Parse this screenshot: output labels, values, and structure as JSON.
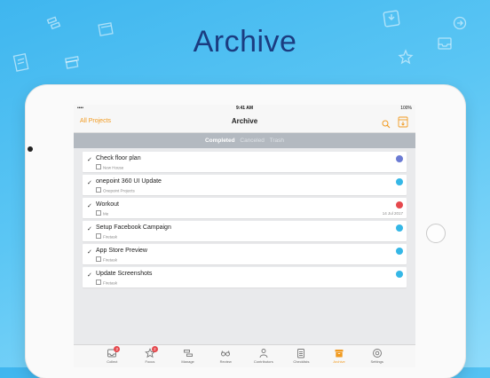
{
  "hero": {
    "title": "Archive"
  },
  "status": {
    "time": "9:41 AM",
    "signal": "•••• ",
    "battery": "100%"
  },
  "navbar": {
    "back": "All Projects",
    "title": "Archive"
  },
  "segments": [
    {
      "label": "Completed",
      "active": true
    },
    {
      "label": "Canceled",
      "active": false
    },
    {
      "label": "Trash",
      "active": false
    }
  ],
  "tasks": [
    {
      "name": "Check floor plan",
      "project": "New House",
      "date": "",
      "avatar_color": "#6b7bd3"
    },
    {
      "name": "onepoint 360 UI Update",
      "project": "Onepoint Projects",
      "date": "",
      "avatar_color": "#35b7e6"
    },
    {
      "name": "Workout",
      "project": "Me",
      "date": "14 Jul 2017",
      "avatar_color": "#e5484d"
    },
    {
      "name": "Setup Facebook Campaign",
      "project": "Firetask",
      "date": "",
      "avatar_color": "#35b7e6"
    },
    {
      "name": "App Store Preview",
      "project": "Firetask",
      "date": "",
      "avatar_color": "#35b7e6"
    },
    {
      "name": "Update Screenshots",
      "project": "Firetask",
      "date": "",
      "avatar_color": "#35b7e6"
    }
  ],
  "tabs": [
    {
      "label": "Collect",
      "icon": "inbox-icon",
      "badge": "2"
    },
    {
      "label": "Focus",
      "icon": "star-icon",
      "badge": "2"
    },
    {
      "label": "Manage",
      "icon": "manage-icon",
      "badge": ""
    },
    {
      "label": "Review",
      "icon": "glasses-icon",
      "badge": ""
    },
    {
      "label": "Contributors",
      "icon": "contributors-icon",
      "badge": ""
    },
    {
      "label": "Checklists",
      "icon": "checklist-icon",
      "badge": ""
    },
    {
      "label": "Archive",
      "icon": "archive-icon",
      "badge": ""
    },
    {
      "label": "Settings",
      "icon": "settings-icon",
      "badge": ""
    }
  ],
  "colors": {
    "accent": "#f19a1f",
    "title": "#1b3c80",
    "badge": "#e5484d"
  }
}
